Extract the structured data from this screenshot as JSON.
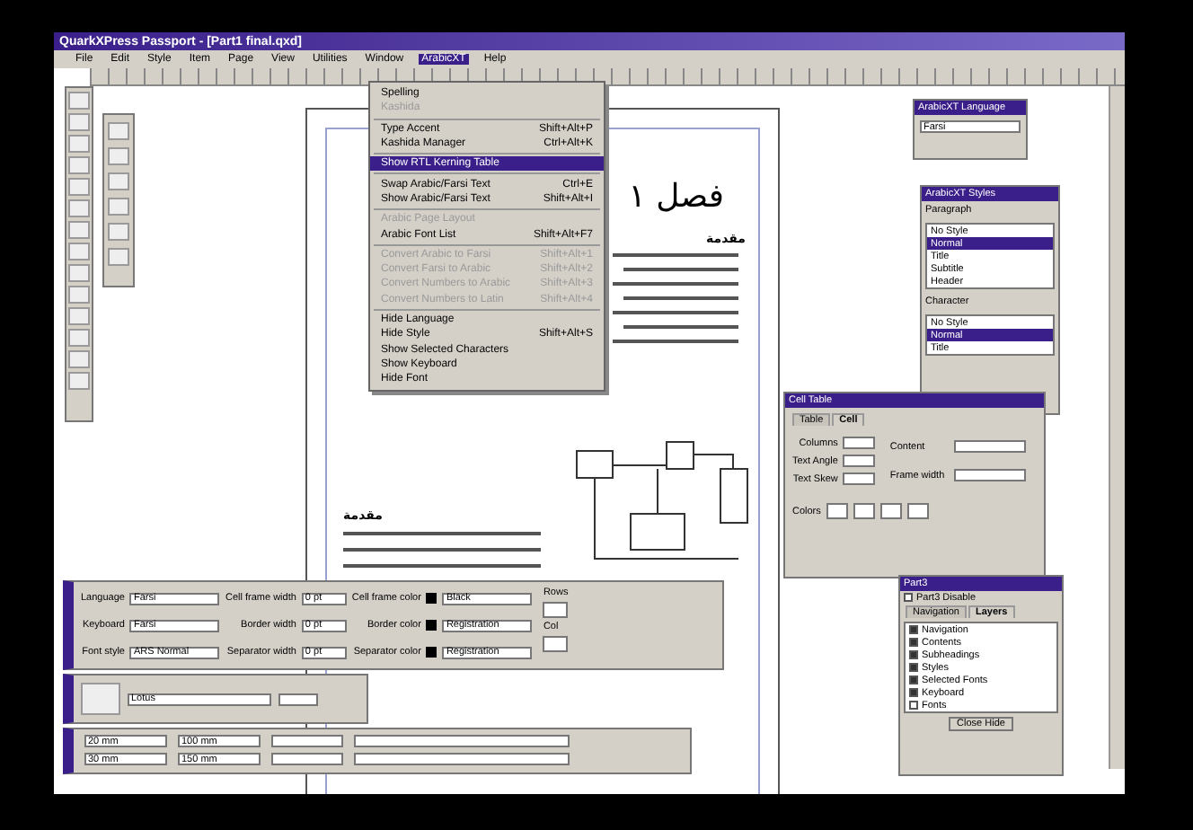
{
  "window": {
    "title": "QuarkXPress Passport - [Part1 final.qxd]"
  },
  "menu_bar": [
    {
      "label": "File",
      "selected": false
    },
    {
      "label": "Edit",
      "selected": false
    },
    {
      "label": "Style",
      "selected": false
    },
    {
      "label": "Item",
      "selected": false
    },
    {
      "label": "Page",
      "selected": false
    },
    {
      "label": "View",
      "selected": false
    },
    {
      "label": "Utilities",
      "selected": false
    },
    {
      "label": "Window",
      "selected": false
    },
    {
      "label": "ArabicXT",
      "selected": true
    },
    {
      "label": "Help",
      "selected": false
    }
  ],
  "open_menu": [
    {
      "kind": "item",
      "label": "Spelling",
      "disabled": false,
      "selected": false
    },
    {
      "kind": "item",
      "label": "Kashida",
      "disabled": true,
      "selected": false
    },
    {
      "kind": "separator"
    },
    {
      "kind": "item",
      "label": "Type Accent",
      "shortcut": "Shift+Alt+P",
      "disabled": false,
      "selected": false
    },
    {
      "kind": "item",
      "label": "Kashida Manager",
      "shortcut": "Ctrl+Alt+K",
      "disabled": false,
      "selected": false
    },
    {
      "kind": "separator"
    },
    {
      "kind": "item",
      "label": "Show RTL Kerning Table",
      "disabled": false,
      "selected": true
    },
    {
      "kind": "separator"
    },
    {
      "kind": "item",
      "label": "Swap Arabic/Farsi Text",
      "shortcut": "Ctrl+E",
      "disabled": false,
      "selected": false
    },
    {
      "kind": "item",
      "label": "Show Arabic/Farsi Text",
      "shortcut": "Shift+Alt+I",
      "disabled": false,
      "selected": false
    },
    {
      "kind": "separator"
    },
    {
      "kind": "item",
      "label": "Arabic Page Layout",
      "disabled": true,
      "selected": false
    },
    {
      "kind": "item",
      "label": "Arabic Font List",
      "shortcut": "Shift+Alt+F7",
      "disabled": false,
      "selected": false
    },
    {
      "kind": "separator"
    },
    {
      "kind": "item",
      "label": "Convert Arabic to Farsi",
      "shortcut": "Shift+Alt+1",
      "disabled": true,
      "selected": false
    },
    {
      "kind": "item",
      "label": "Convert Farsi to Arabic",
      "shortcut": "Shift+Alt+2",
      "disabled": true,
      "selected": false
    },
    {
      "kind": "item",
      "label": "Convert Numbers to Arabic",
      "shortcut": "Shift+Alt+3",
      "disabled": true,
      "selected": false
    },
    {
      "kind": "item",
      "label": "Convert Numbers to Latin",
      "shortcut": "Shift+Alt+4",
      "disabled": true,
      "selected": false
    },
    {
      "kind": "separator"
    },
    {
      "kind": "item",
      "label": "Hide Language",
      "disabled": false,
      "selected": false
    },
    {
      "kind": "item",
      "label": "Hide Style",
      "shortcut": "Shift+Alt+S",
      "disabled": false,
      "selected": false
    },
    {
      "kind": "item",
      "label": "Show Selected Characters",
      "disabled": false,
      "selected": false
    },
    {
      "kind": "item",
      "label": "Show Keyboard",
      "disabled": false,
      "selected": false
    },
    {
      "kind": "item",
      "label": "Hide Font",
      "disabled": false,
      "selected": false
    }
  ],
  "document": {
    "heading": "فصل ۱",
    "subheading": "مقدمة",
    "section_heading": "مقدمة"
  },
  "language_palette": {
    "title": "ArabicXT Language",
    "value": "Farsi"
  },
  "styles_palette": {
    "title": "ArabicXT Styles",
    "paragraph_label": "Paragraph",
    "paragraph_styles": [
      {
        "label": "No Style",
        "selected": false
      },
      {
        "label": "Normal",
        "selected": true
      },
      {
        "label": "Title",
        "selected": false
      },
      {
        "label": "Subtitle",
        "selected": false
      },
      {
        "label": "Header",
        "selected": false
      }
    ],
    "character_label": "Character",
    "character_styles": [
      {
        "label": "No Style",
        "selected": false
      },
      {
        "label": "Normal",
        "selected": true
      },
      {
        "label": "Title",
        "selected": false
      }
    ]
  },
  "cell_dialog": {
    "title": "Cell Table",
    "tabs": [
      {
        "label": "Table",
        "selected": false
      },
      {
        "label": "Cell",
        "selected": true
      }
    ],
    "fields": [
      "Columns",
      "Text Angle",
      "Text Skew"
    ],
    "content_label": "Content",
    "frame_width_label": "Frame width",
    "colors_label": "Colors"
  },
  "table_palette": {
    "rows": [
      {
        "label": "Language",
        "value": "Farsi",
        "width_label": "Cell frame width",
        "width_value": "0 pt",
        "color_label": "Cell frame color",
        "color_value": "Black"
      },
      {
        "label": "Keyboard",
        "value": "Farsi",
        "width_label": "Border width",
        "width_value": "0 pt",
        "color_label": "Border color",
        "color_value": "Registration"
      },
      {
        "label": "Font style",
        "value": "ARS Normal",
        "width_label": "Separator width",
        "width_value": "0 pt",
        "color_label": "Separator color",
        "color_value": "Registration"
      }
    ],
    "rows_label": "Rows",
    "cols_label": "Col"
  },
  "layers_palette": {
    "title": "Part3",
    "disable_label": "Part3 Disable",
    "disable_checked": false,
    "tabs": [
      {
        "label": "Navigation",
        "selected": false
      },
      {
        "label": "Layers",
        "selected": true
      }
    ],
    "items": [
      {
        "label": "Navigation",
        "checked": true
      },
      {
        "label": "Contents",
        "checked": true
      },
      {
        "label": "Subheadings",
        "checked": true
      },
      {
        "label": "Styles",
        "checked": true
      },
      {
        "label": "Selected Fonts",
        "checked": true
      },
      {
        "label": "Keyboard",
        "checked": true
      },
      {
        "label": "Fonts",
        "checked": false
      }
    ],
    "button": "Close Hide"
  },
  "font_palette": {
    "value": "Lotus"
  },
  "measurements": {
    "x": "20 mm",
    "y": "30 mm",
    "w": "100 mm",
    "h": "150 mm"
  }
}
